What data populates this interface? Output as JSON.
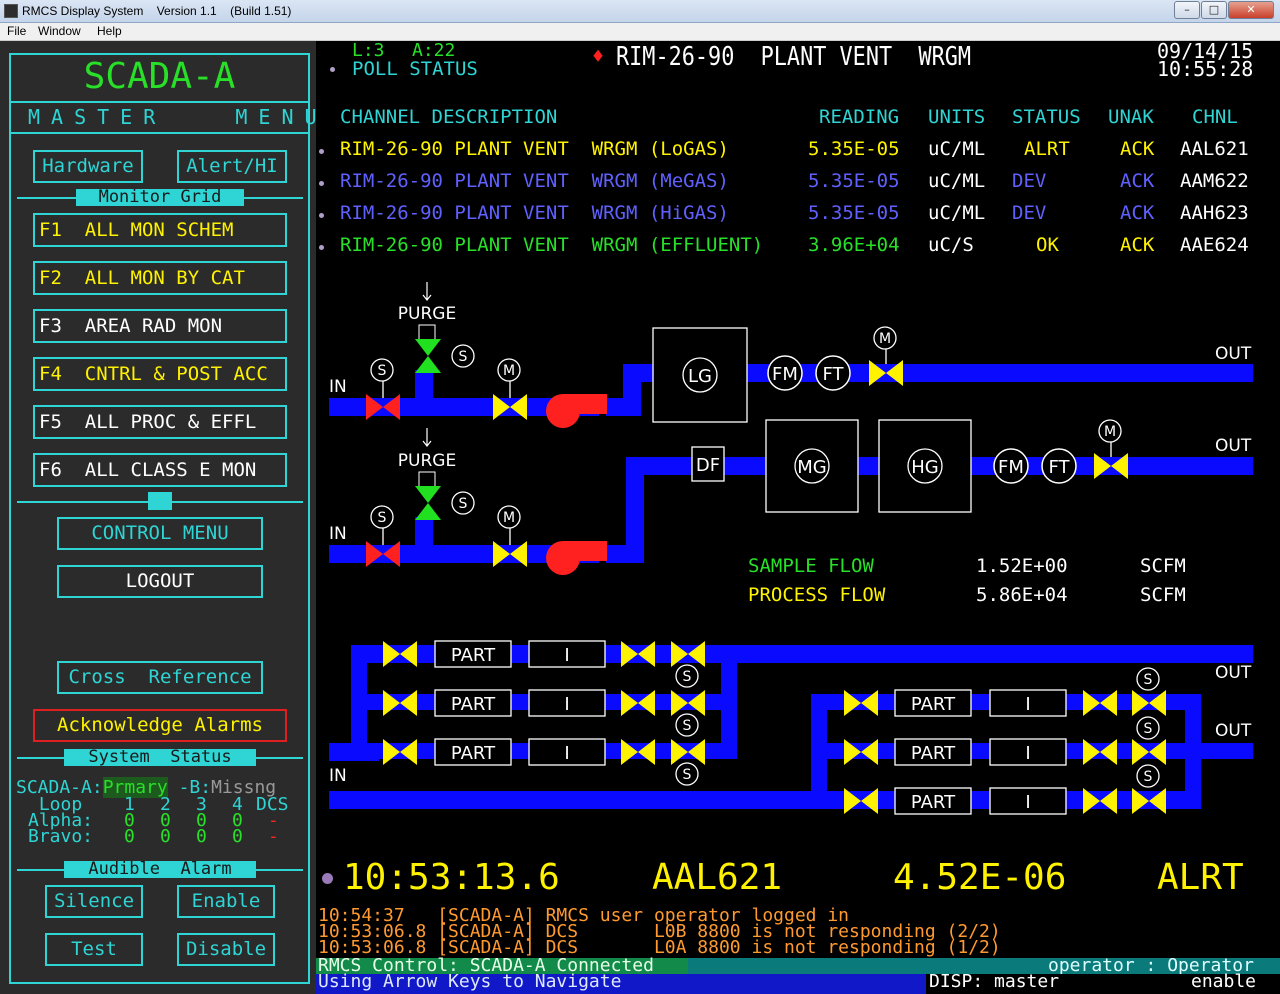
{
  "window": {
    "title": "RMCS Display System    Version 1.1    (Build 1.51)"
  },
  "menu": [
    "File",
    "Window",
    "Help"
  ],
  "sidebar": {
    "title": "SCADA-A",
    "master_menu": "MASTER   MENU",
    "hardware": "Hardware",
    "alert_hi": "Alert/HI",
    "monitor_grid": "Monitor Grid",
    "f_keys": [
      {
        "key": "F1",
        "label": "ALL MON SCHEM"
      },
      {
        "key": "F2",
        "label": "ALL MON BY CAT"
      },
      {
        "key": "F3",
        "label": "AREA RAD MON"
      },
      {
        "key": "F4",
        "label": "CNTRL & POST ACC"
      },
      {
        "key": "F5",
        "label": "ALL PROC & EFFL"
      },
      {
        "key": "F6",
        "label": "ALL CLASS E MON"
      }
    ],
    "control_menu": "CONTROL MENU",
    "logout": "LOGOUT",
    "cross_reference": "Cross  Reference",
    "ack_alarms": "Acknowledge Alarms",
    "system_status": "System  Status",
    "scada_a_label": "SCADA-A:",
    "scada_a_state": "Prmary",
    "scada_b_label": " -B:",
    "scada_b_state": "Missng",
    "loop_label": " Loop ",
    "loops": [
      "1",
      "2",
      "3",
      "4",
      "DCS"
    ],
    "alpha_label": "Alpha:",
    "alpha_vals": [
      "0",
      "0",
      "0",
      "0",
      "-"
    ],
    "bravo_label": "Bravo:",
    "bravo_vals": [
      "0",
      "0",
      "0",
      "0",
      "-"
    ],
    "audible_alarm": "Audible  Alarm",
    "silence": "Silence",
    "enable": "Enable",
    "test": "Test",
    "disable": "Disable"
  },
  "header": {
    "loop_count": "L:3",
    "alarm_count": "A:22",
    "poll_status": "POLL STATUS",
    "title": "RIM-26-90  PLANT VENT  WRGM",
    "date": "09/14/15",
    "time": "10:55:28"
  },
  "table": {
    "headers": [
      "CHANNEL DESCRIPTION",
      "READING",
      "UNITS",
      "STATUS",
      "UNAK",
      "CHNL"
    ],
    "rows": [
      {
        "desc": "RIM-26-90 PLANT VENT  WRGM (LoGAS)",
        "reading": "5.35E-05",
        "units": "uC/ML",
        "status": "ALRT",
        "unak": "ACK",
        "chnl": "AAL621",
        "color": "#fff200",
        "status_color": "#fff200"
      },
      {
        "desc": "RIM-26-90 PLANT VENT  WRGM (MeGAS)",
        "reading": "5.35E-05",
        "units": "uC/ML",
        "status": "DEV",
        "unak": "ACK",
        "chnl": "AAM622",
        "color": "#6060ff",
        "status_color": "#6060ff"
      },
      {
        "desc": "RIM-26-90 PLANT VENT  WRGM (HiGAS)",
        "reading": "5.35E-05",
        "units": "uC/ML",
        "status": "DEV",
        "unak": "ACK",
        "chnl": "AAH623",
        "color": "#6060ff",
        "status_color": "#6060ff"
      },
      {
        "desc": "RIM-26-90 PLANT VENT  WRGM (EFFLUENT)",
        "reading": "3.96E+04",
        "units": "uC/S",
        "status": "OK",
        "unak": "ACK",
        "chnl": "AAE624",
        "color": "#28e028",
        "status_color": "#fff200"
      }
    ]
  },
  "schematic": {
    "purge": "PURGE",
    "in": "IN",
    "out": "OUT",
    "s": "S",
    "m": "M",
    "lg": "LG",
    "mg": "MG",
    "hg": "HG",
    "df": "DF",
    "fm": "FM",
    "ft": "FT",
    "part": "PART",
    "i": "I",
    "sample_flow_label": "SAMPLE FLOW",
    "sample_flow_value": "1.52E+00",
    "sample_flow_units": "SCFM",
    "process_flow_label": "PROCESS FLOW",
    "process_flow_value": "5.86E+04",
    "process_flow_units": "SCFM"
  },
  "alarm_line": {
    "time": "10:53:13.6",
    "chnl": "AAL621",
    "value": "4.52E-06",
    "status": "ALRT"
  },
  "log": [
    "10:54:37   [SCADA-A] RMCS user operator logged in",
    "10:53:06.8 [SCADA-A] DCS       L0B 8800 is not responding (2/2)",
    "10:53:06.8 [SCADA-A] DCS       L0A 8800 is not responding (1/2)"
  ],
  "statusbar": {
    "control": "RMCS Control: SCADA-A Connected",
    "operator": "operator : Operator",
    "nav": "Using Arrow Keys to Navigate",
    "disp": "DISP: master",
    "enable": "enable"
  },
  "colors": {
    "cyan": "#2fd4d4",
    "yellow": "#fff200",
    "green": "#28e028",
    "blue": "#6060ff",
    "pipe": "#0a0aff",
    "red": "#ff2020"
  }
}
